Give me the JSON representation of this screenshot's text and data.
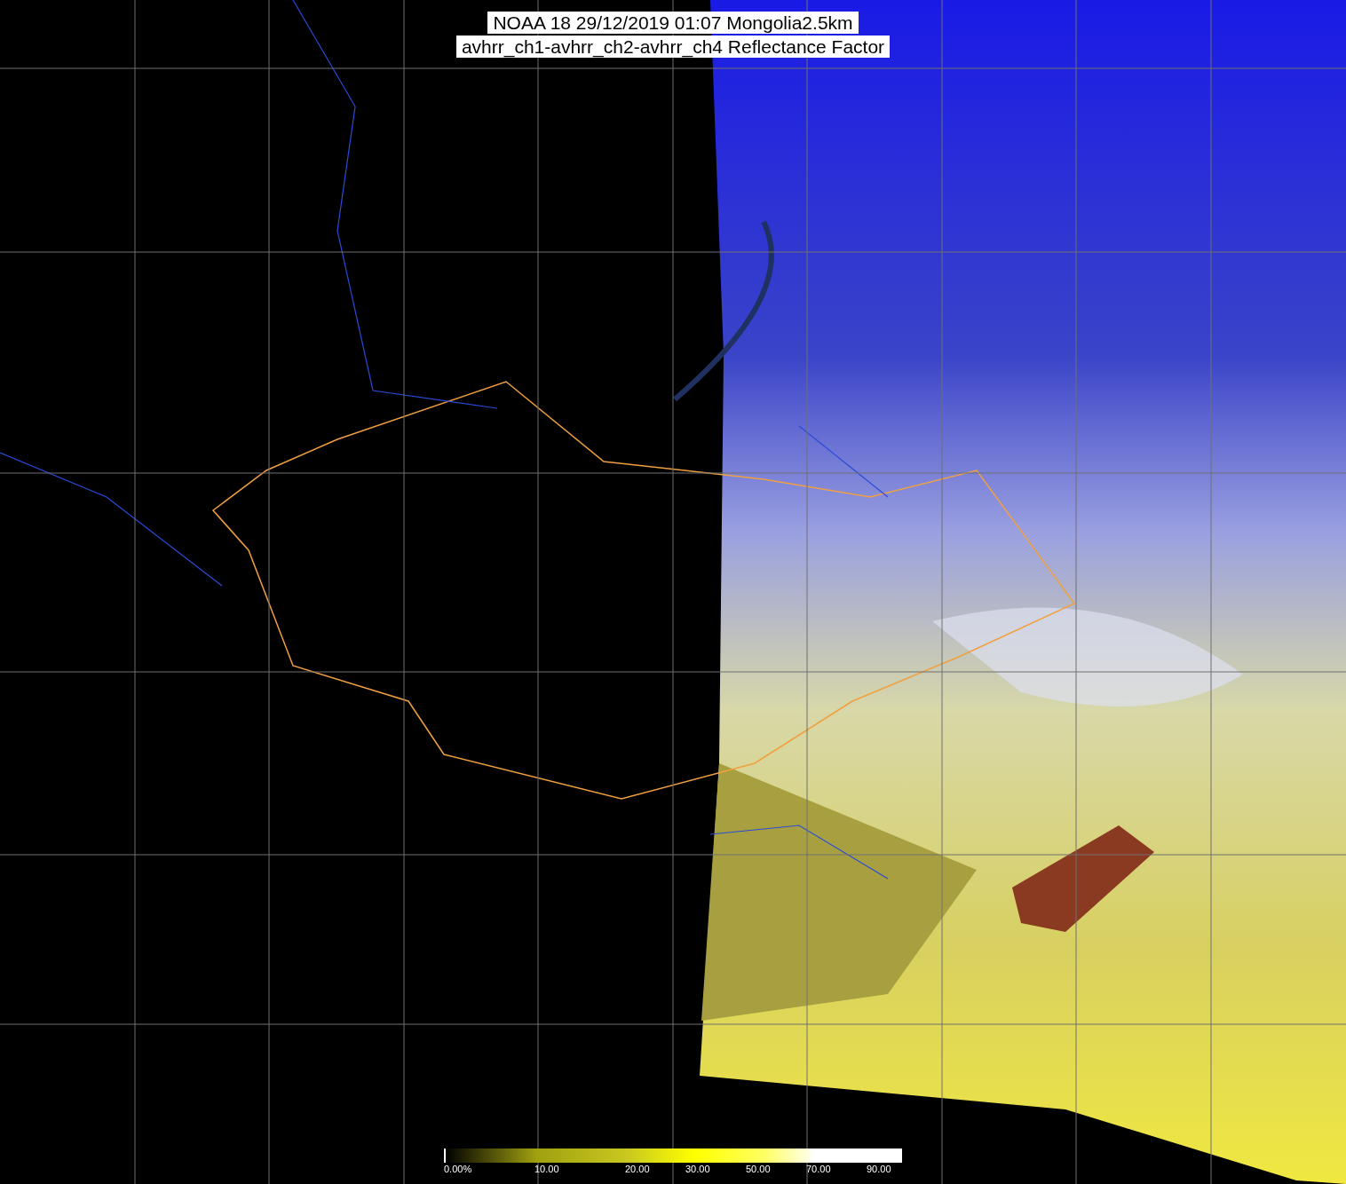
{
  "title": {
    "lines": [
      "NOAA 18 29/12/2019 01:07 Mongolia2.5km",
      "avhrr_ch1-avhrr_ch2-avhrr_ch4 Reflectance Factor"
    ]
  },
  "colorbar": {
    "ticks": [
      "0.00%",
      "10.00",
      "20.00",
      "30.00",
      "50.00",
      "70.00",
      "90.00"
    ]
  }
}
